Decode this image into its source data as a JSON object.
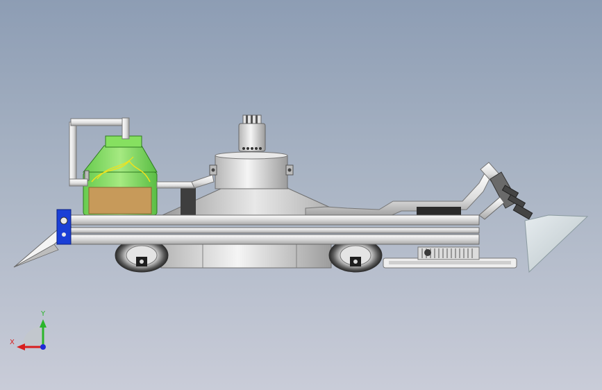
{
  "view": {
    "background_top": "#8d9db4",
    "background_bottom": "#c9ccd8"
  },
  "triad": {
    "x_label": "X",
    "y_label": "Y",
    "x_color": "#d81e1e",
    "y_color": "#2bb52b",
    "z_color": "#1e2ad8"
  },
  "colors": {
    "tank_glass": "#7fe05a",
    "tank_fill": "#c79a5a",
    "chassis_metal": "#e6e6e6",
    "bracket_blue": "#1a3fd6",
    "pipe": "#f2f2f2"
  }
}
